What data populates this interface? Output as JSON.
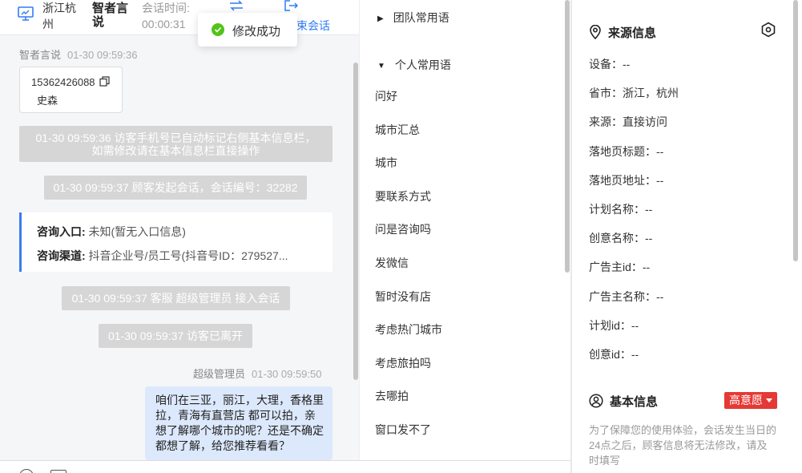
{
  "header": {
    "location": "浙江杭州",
    "user_name": "智者言说",
    "session_time_label": "会话时间:",
    "session_time_value": "00:00:31",
    "end_label": "束会话"
  },
  "toast": {
    "text": "修改成功"
  },
  "visitor": {
    "name": "智者言说",
    "time": "01-30 09:59:36",
    "phone": "15362426088",
    "alias": "史森"
  },
  "messages": {
    "system1": "01-30 09:59:36 访客手机号已自动标记右侧基本信息栏，如需修改请在基本信息栏直接操作",
    "system2": "01-30 09:59:37 顾客发起会话，会话编号：32282",
    "consult_entry_label": "咨询入口:",
    "consult_entry_value": " 未知(暂无入口信息)",
    "consult_channel_label": "咨询渠道:",
    "consult_channel_value": " 抖音企业号/员工号(抖音号ID：279527...",
    "system3": "01-30 09:59:37 客服 超级管理员 接入会话",
    "system4": "01-30 09:59:37 访客已离开",
    "agent_name": "超级管理员",
    "agent_time": "01-30 09:59:50",
    "agent_text": "咱们在三亚，丽江，大理，香格里拉，青海有直营店 都可以拍，亲想了解哪个城市的呢？还是不确定都想了解，给您推荐看看？"
  },
  "phrases": {
    "team_group": "团队常用语",
    "personal_group": "个人常用语",
    "items": [
      "问好",
      "城市汇总",
      "城市",
      "要联系方式",
      "问是咨询吗",
      "发微信",
      "暂时没有店",
      "考虑热门城市",
      "考虑旅拍吗",
      "去哪拍",
      "窗口发不了"
    ]
  },
  "source_info": {
    "title": "来源信息",
    "fields": [
      "设备：--",
      "省市：浙江，杭州",
      "来源：直接访问",
      "落地页标题：--",
      "落地页地址：--",
      "计划名称：--",
      "创意名称：--",
      "广告主id：--",
      "广告主名称：--",
      "计划id：--",
      "创意id：--"
    ]
  },
  "basic_info": {
    "title": "基本信息",
    "intent_badge": "高意愿",
    "notice": "为了保障您的使用体验，会话发生当日的24点之后，顾客信息将无法修改，请及时填写"
  },
  "colors": {
    "accent": "#2f7ef5",
    "badge": "#e53935",
    "success": "#52c41a",
    "bubble": "#dce8fb"
  }
}
